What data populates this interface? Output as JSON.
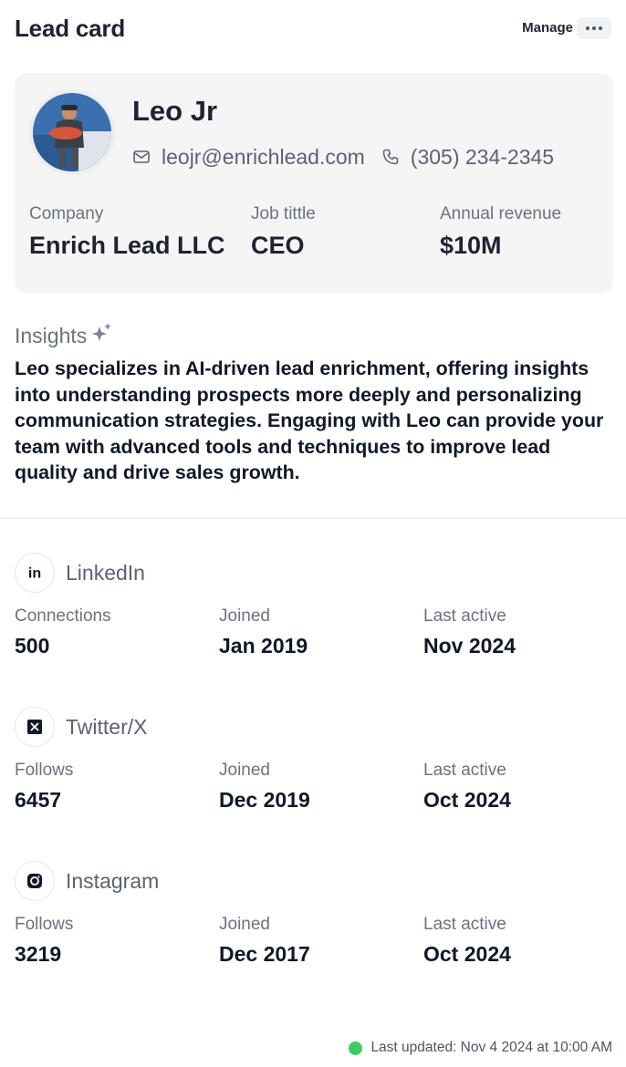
{
  "header": {
    "title": "Lead card",
    "manage_label": "Manage",
    "more_icon": "ellipsis-icon"
  },
  "profile": {
    "name": "Leo Jr",
    "email": "leojr@enrichlead.com",
    "phone": "(305) 234-2345",
    "fields": [
      {
        "label": "Company",
        "value": "Enrich Lead LLC"
      },
      {
        "label": "Job tittle",
        "value": "CEO"
      },
      {
        "label": "Annual revenue",
        "value": "$10M"
      }
    ]
  },
  "insights": {
    "heading": "Insights",
    "icon": "sparkle-icon",
    "text": "Leo specializes in AI-driven lead enrichment, offering insights into understanding prospects more deeply and personalizing communication strategies. Engaging with Leo can provide your team with advanced tools and techniques to improve lead quality and drive sales growth."
  },
  "socials": [
    {
      "name": "LinkedIn",
      "icon": "linkedin-icon",
      "stats": [
        {
          "label": "Connections",
          "value": "500"
        },
        {
          "label": "Joined",
          "value": "Jan 2019"
        },
        {
          "label": "Last active",
          "value": "Nov 2024"
        }
      ]
    },
    {
      "name": "Twitter/X",
      "icon": "x-icon",
      "stats": [
        {
          "label": "Follows",
          "value": "6457"
        },
        {
          "label": "Joined",
          "value": "Dec 2019"
        },
        {
          "label": "Last active",
          "value": "Oct 2024"
        }
      ]
    },
    {
      "name": "Instagram",
      "icon": "instagram-icon",
      "stats": [
        {
          "label": "Follows",
          "value": "3219"
        },
        {
          "label": "Joined",
          "value": "Dec 2017"
        },
        {
          "label": "Last active",
          "value": "Oct 2024"
        }
      ]
    }
  ],
  "footer": {
    "last_updated": "Last updated: Nov 4 2024 at 10:00 AM",
    "status_color": "#3fcb63"
  },
  "colors": {
    "card_bg": "#f5f5f6",
    "text_primary": "#1f2330",
    "text_muted": "#6b7280"
  }
}
